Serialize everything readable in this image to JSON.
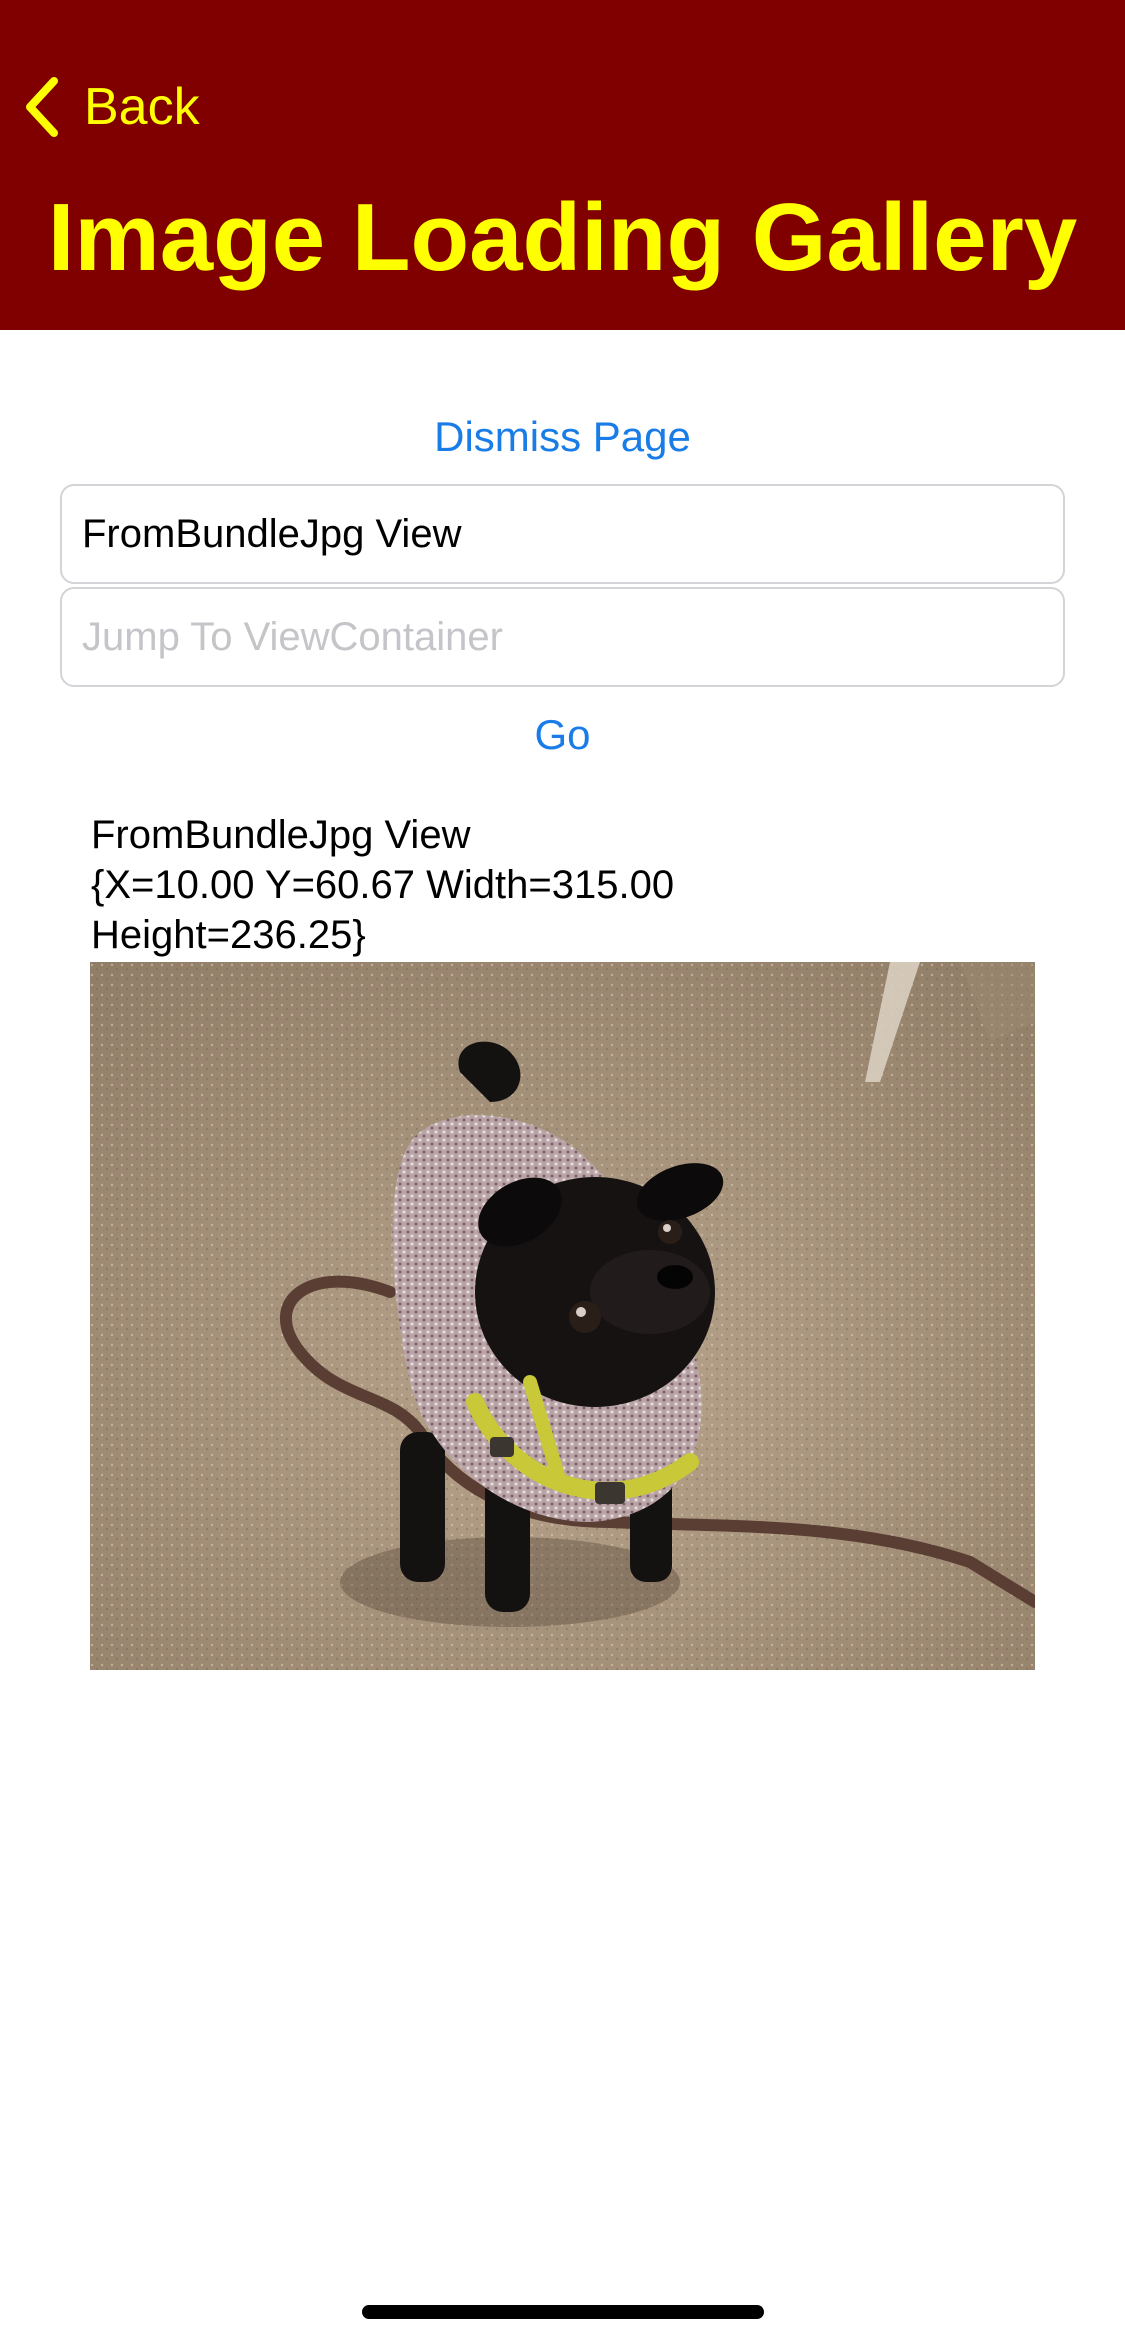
{
  "nav": {
    "back_label": "Back",
    "title": "Image Loading Gallery"
  },
  "actions": {
    "dismiss_label": "Dismiss Page",
    "go_label": "Go"
  },
  "fields": {
    "view_name_value": "FromBundleJpg View",
    "jump_placeholder": "Jump To ViewContainer"
  },
  "view_info": {
    "line1": "FromBundleJpg View",
    "line2": "{X=10.00 Y=60.67 Width=315.00",
    "line3": "Height=236.25}"
  },
  "image": {
    "description_icon": "pug-photo"
  },
  "colors": {
    "nav_background": "#800000",
    "nav_text": "#FFFF00",
    "link": "#1a7ce6"
  }
}
